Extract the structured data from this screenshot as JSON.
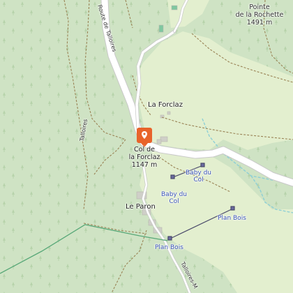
{
  "map": {
    "labels": {
      "pointe_rochette": {
        "name": "Pointe\nde la Rochette",
        "elevation": "1491 m"
      },
      "route_talloires": "Route de Talloires",
      "talloires": "Talloires",
      "la_forclaz": "La Forclaz",
      "col_forclaz": {
        "name": "Col de\nla Forclaz",
        "elevation": "1147 m"
      },
      "baby_du_col_1": "Baby du\nCol",
      "baby_du_col_2": "Baby du\nCol",
      "le_paron": "Le Paron",
      "plan_bois_1": "Plan Bois",
      "plan_bois_2": "Plan Bois",
      "talloires_road_bottom": "Talloires-M"
    },
    "marker": {
      "icon": "location-pin-icon",
      "color": "#e8632a"
    },
    "colors": {
      "forest": "#cfe3c4",
      "meadow": "#e3efcf",
      "road": "#ffffff",
      "track": "#9a8456",
      "water": "#8ecfd6",
      "lift": "#4a4a6a"
    }
  }
}
